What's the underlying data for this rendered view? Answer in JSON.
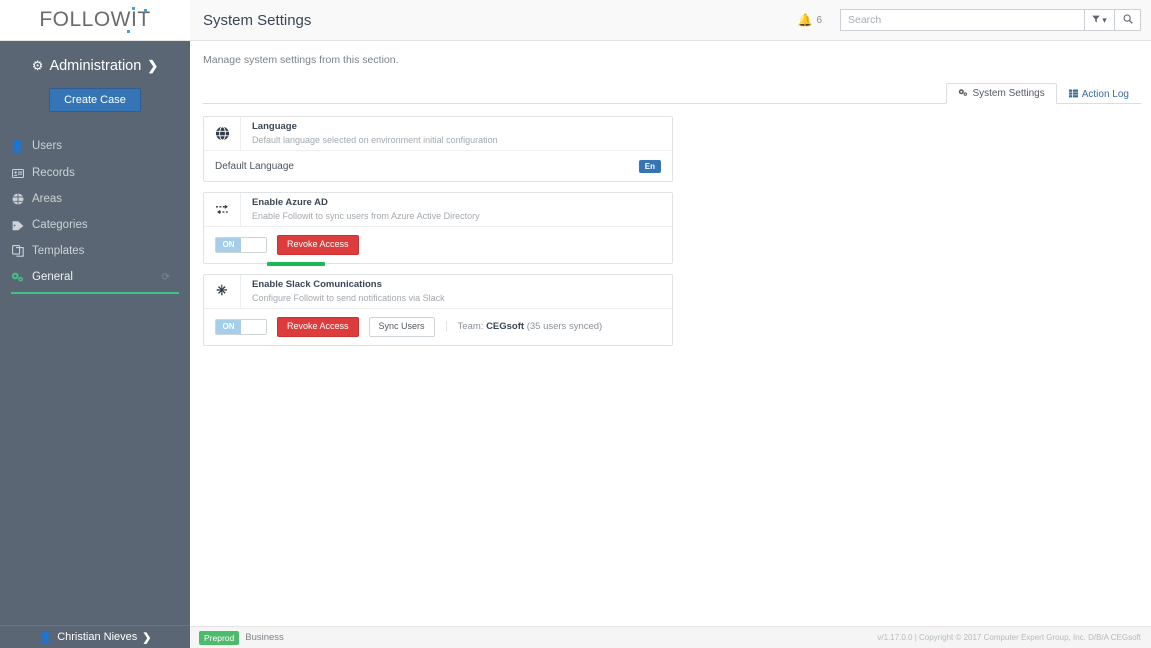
{
  "sidebar": {
    "logo": "FOLLOWIT",
    "section": {
      "label": "Administration",
      "gear_icon": "gear-icon",
      "chevron_icon": "chevron-right-icon"
    },
    "create_case_label": "Create Case",
    "items": [
      {
        "label": "Users",
        "icon": "user-icon"
      },
      {
        "label": "Records",
        "icon": "id-card-icon"
      },
      {
        "label": "Areas",
        "icon": "cube-icon"
      },
      {
        "label": "Categories",
        "icon": "tag-icon"
      },
      {
        "label": "Templates",
        "icon": "copy-icon"
      },
      {
        "label": "General",
        "icon": "gears-icon",
        "active": true,
        "trailing_icon": "refresh-icon"
      }
    ],
    "user": {
      "name": "Christian Nieves",
      "icon": "user-icon",
      "chevron_icon": "chevron-right-icon"
    }
  },
  "header": {
    "title": "System Settings",
    "notifications": {
      "icon": "bell-icon",
      "count": "6"
    },
    "search": {
      "placeholder": "Search",
      "value": "",
      "filter_icon": "filter-icon",
      "filter_caret": "caret-down-icon",
      "search_icon": "search-icon"
    }
  },
  "page": {
    "description": "Manage system settings from this section.",
    "tabs": [
      {
        "label": "System Settings",
        "icon": "gears-icon",
        "active": true
      },
      {
        "label": "Action Log",
        "icon": "list-grid-icon",
        "active": false
      }
    ]
  },
  "cards": {
    "language": {
      "icon": "globe-icon",
      "title": "Language",
      "subtitle": "Default language selected on environment initial configuration",
      "row_label": "Default Language",
      "badge": "En",
      "badge_color": "#3575b5"
    },
    "azure": {
      "icon": "exchange-arrows-icon",
      "title": "Enable Azure AD",
      "subtitle": "Enable Followit to sync users from Azure Active Directory",
      "toggle_state": "ON",
      "revoke_label": "Revoke Access",
      "progress_color": "#19b955"
    },
    "slack": {
      "icon": "slack-icon",
      "title": "Enable Slack Comunications",
      "subtitle": "Configure Followit to send notifications via Slack",
      "toggle_state": "ON",
      "revoke_label": "Revoke Access",
      "sync_label": "Sync Users",
      "team_prefix": "Team:",
      "team_name": "CEGsoft",
      "team_suffix": "(35 users synced)"
    }
  },
  "footer": {
    "env_badge": "Preprod",
    "env_name": "Business",
    "copyright": "v/1.17.0.0 | Copyright © 2017 Computer Expert Group, Inc. D/B/A CEGsoft"
  }
}
